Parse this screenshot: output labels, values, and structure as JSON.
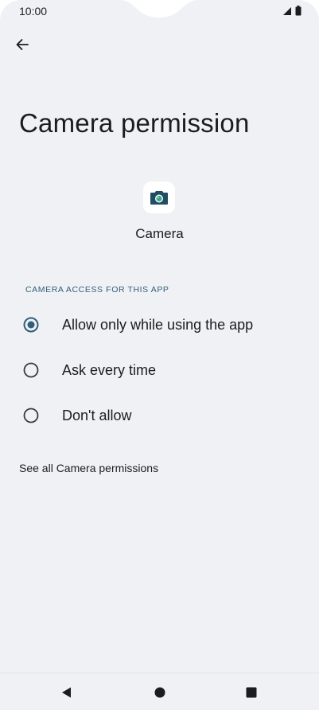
{
  "status_bar": {
    "time": "10:00"
  },
  "header": {
    "title": "Camera permission"
  },
  "app": {
    "name": "Camera",
    "icon": "camera-icon",
    "icon_color": "#1f4e63",
    "lens_color": "#3fa48f"
  },
  "permission": {
    "section_header": "CAMERA ACCESS FOR THIS APP",
    "options": [
      {
        "label": "Allow only while using the app",
        "selected": true
      },
      {
        "label": "Ask every time",
        "selected": false
      },
      {
        "label": "Don't allow",
        "selected": false
      }
    ],
    "see_all_link": "See all Camera permissions"
  },
  "colors": {
    "background": "#f0f1f4",
    "accent": "#2f5f7a",
    "text": "#1c1c1e"
  }
}
